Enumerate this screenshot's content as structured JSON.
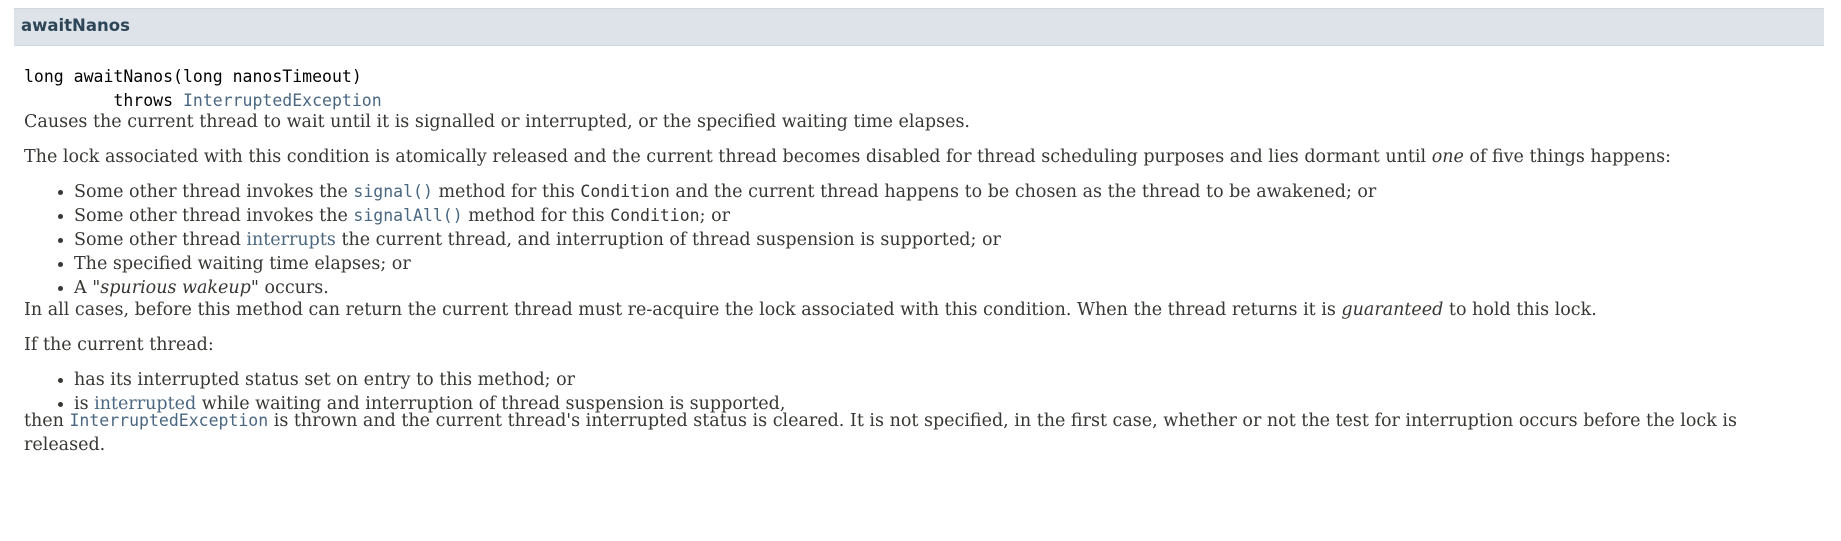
{
  "header": {
    "title": "awaitNanos"
  },
  "signature": {
    "line1": "long awaitNanos(long nanosTimeout)",
    "throws_kw": "throws",
    "throws_type": "InterruptedException"
  },
  "desc1": "Causes the current thread to wait until it is signalled or interrupted, or the specified waiting time elapses.",
  "desc2": {
    "before": "The lock associated with this condition is atomically released and the current thread becomes disabled for thread scheduling purposes and lies dormant until ",
    "emph": "one",
    "after": " of five things happens:"
  },
  "list1": [
    {
      "a": "Some other thread invokes the ",
      "link": "signal()",
      "b": " method for this ",
      "code": "Condition",
      "c": " and the current thread happens to be chosen as the thread to be awakened; or"
    },
    {
      "a": "Some other thread invokes the ",
      "link": "signalAll()",
      "b": " method for this ",
      "code": "Condition",
      "c": "; or"
    },
    {
      "a": "Some other thread ",
      "link": "interrupts",
      "b": " the current thread, and interruption of thread suspension is supported; or"
    },
    {
      "a": "The specified waiting time elapses; or"
    },
    {
      "a": "A \"",
      "emph": "spurious wakeup",
      "b": "\" occurs."
    }
  ],
  "desc3": {
    "before": "In all cases, before this method can return the current thread must re-acquire the lock associated with this condition. When the thread returns it is ",
    "emph": "guaranteed",
    "after": " to hold this lock."
  },
  "desc4": "If the current thread:",
  "list2": [
    {
      "a": "has its interrupted status set on entry to this method; or"
    },
    {
      "a": "is ",
      "link": "interrupted",
      "b": " while waiting and interruption of thread suspension is supported,"
    }
  ],
  "desc5": {
    "before": "then ",
    "link": "InterruptedException",
    "after": " is thrown and the current thread's interrupted status is cleared. It is not specified, in the first case, whether or not the test for interruption occurs before the lock is released."
  }
}
